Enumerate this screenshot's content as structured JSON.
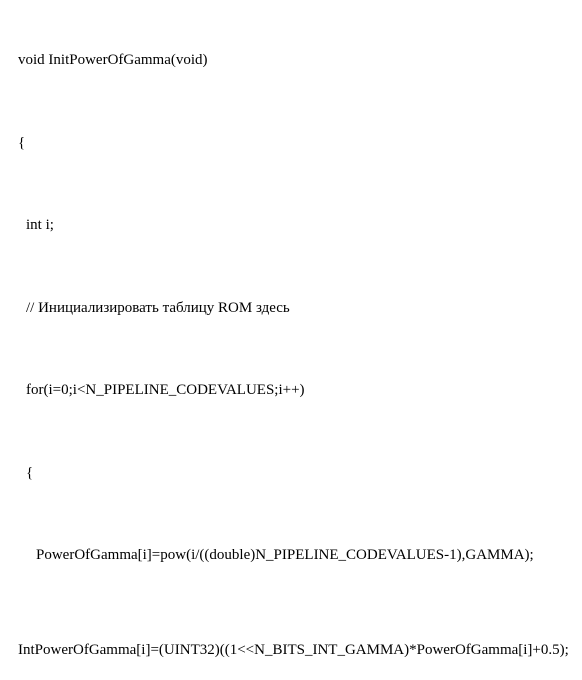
{
  "code": {
    "line1": "void InitPowerOfGamma(void)",
    "line2": "{",
    "line3": "int i;",
    "line4": "// Инициализировать таблицу ROM здесь",
    "line5": "for(i=0;i<N_PIPELINE_CODEVALUES;i++)",
    "line6": "{",
    "line7": "PowerOfGamma[i]=pow(i/((double)N_PIPELINE_CODEVALUES-1),GAMMA);",
    "line8": "IntPowerOfGamma[i]=(UINT32)((1<<N_BITS_INT_GAMMA)*PowerOfGamma[i]+0.5);"
  }
}
